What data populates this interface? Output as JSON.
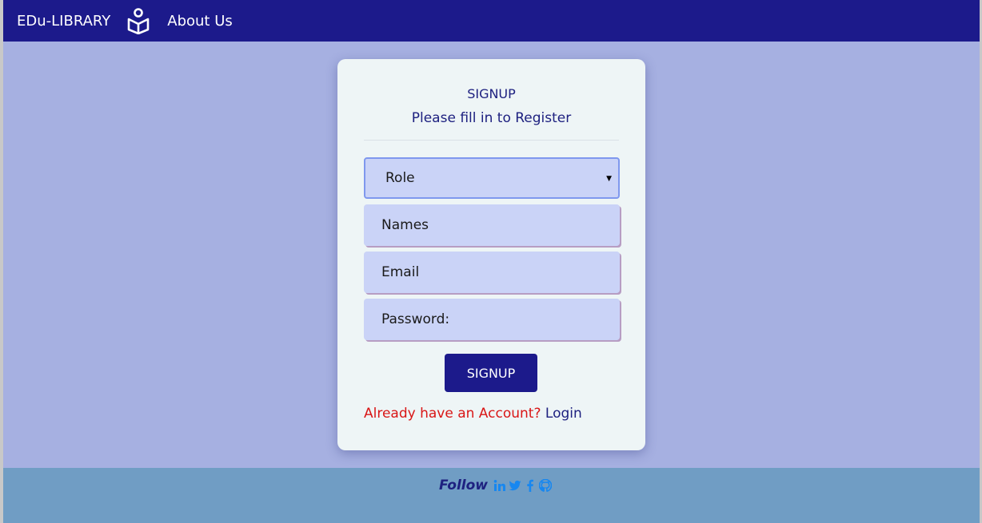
{
  "navbar": {
    "brand": "EDu-LIBRARY",
    "logo_icon": "book-reader-icon",
    "about_link": "About Us",
    "colors": {
      "background": "#1c1a8b",
      "text": "#ffffff"
    }
  },
  "signup_card": {
    "title": "SIGNUP",
    "subtitle": "Please fill in to Register",
    "role_select": {
      "selected": "Role"
    },
    "names_input": {
      "placeholder": "Names"
    },
    "email_input": {
      "placeholder": "Email"
    },
    "password_input": {
      "placeholder": "Password:"
    },
    "submit_label": "SIGNUP",
    "account_question": "Already have an Account?",
    "login_link": "Login"
  },
  "footer": {
    "follow_label": "Follow",
    "social_icons": [
      "linkedin-icon",
      "twitter-icon",
      "facebook-icon",
      "github-icon"
    ],
    "icon_color": "#1787f0"
  },
  "colors": {
    "page_background": "#a6b0e1",
    "card_background": "#eef5f6",
    "field_background": "#cad3f7",
    "accent": "#1c1a8b",
    "error_text": "#d91616",
    "footer_background": "#709dc4"
  }
}
